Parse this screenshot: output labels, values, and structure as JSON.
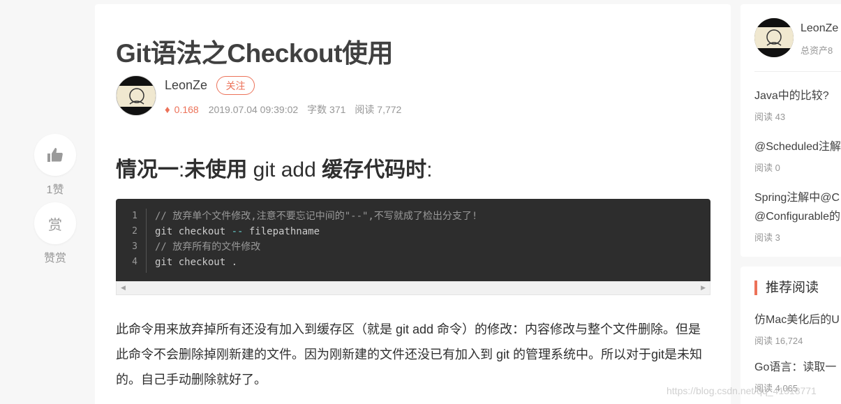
{
  "actions": {
    "like_count": "1赞",
    "reward_icon": "赏",
    "reward_label": "赞赏"
  },
  "article": {
    "title": "Git语法之Checkout使用",
    "author": "LeonZe",
    "follow_label": "关注",
    "score": "0.168",
    "date": "2019.07.04 09:39:02",
    "word_count": "字数 371",
    "reads": "阅读 7,772",
    "heading_bold_1": "情况一",
    "heading_sep": ":",
    "heading_bold_2": "未使用",
    "heading_code": " git add ",
    "heading_bold_3": "缓存代码时",
    "heading_end": ":",
    "code": {
      "line_numbers": [
        "1",
        "2",
        "3",
        "4"
      ],
      "line1": "// 放弃单个文件修改,注意不要忘记中间的\"--\",不写就成了检出分支了!",
      "line2_a": "git checkout ",
      "line2_op": "--",
      "line2_b": " filepathname",
      "line3": "// 放弃所有的文件修改",
      "line4": "git checkout ."
    },
    "paragraph": "此命令用来放弃掉所有还没有加入到缓存区（就是 git add 命令）的修改：内容修改与整个文件删除。但是此命令不会删除掉刚新建的文件。因为刚新建的文件还没已有加入到 git 的管理系统中。所以对于git是未知的。自己手动删除就好了。"
  },
  "sidebar": {
    "author": "LeonZe",
    "assets": "总资产8",
    "items": [
      {
        "title": "Java中的比较?",
        "reads": "阅读 43"
      },
      {
        "title": "@Scheduled注解",
        "reads": "阅读 0"
      },
      {
        "title": "Spring注解中@C",
        "title2": "@Configurable的",
        "reads": "阅读 3"
      }
    ],
    "recommend_title": "推荐阅读",
    "recommend": [
      {
        "title": "仿Mac美化后的U",
        "reads": "阅读 16,724"
      },
      {
        "title": "Go语言：读取一",
        "reads": "阅读 4,065"
      }
    ]
  },
  "watermark": "https://blog.csdn.net/qq_41318771"
}
